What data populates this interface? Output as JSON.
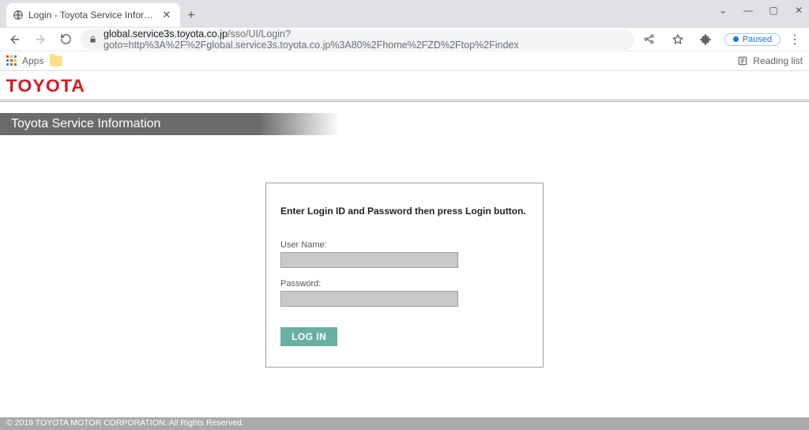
{
  "browser": {
    "tab_title": "Login - Toyota Service Informatio",
    "url_host": "global.service3s.toyota.co.jp",
    "url_path": "/sso/UI/Login?goto=http%3A%2F%2Fglobal.service3s.toyota.co.jp%3A80%2Fhome%2FZD%2Ftop%2Findex",
    "apps_label": "Apps",
    "reading_label": "Reading list",
    "paused_label": "Paused"
  },
  "page": {
    "brand": "TOYOTA",
    "title": "Toyota Service Information",
    "login": {
      "instruction": "Enter Login ID and Password then press Login button.",
      "username_label": "User Name:",
      "password_label": "Password:",
      "button_label": "LOG IN"
    },
    "footer": "© 2019 TOYOTA MOTOR CORPORATION. All Rights Reserved."
  }
}
